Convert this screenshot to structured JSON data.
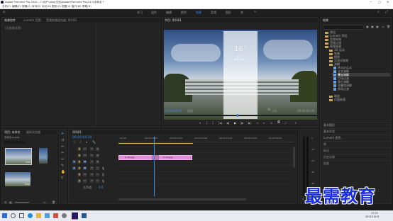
{
  "window": {
    "title": "Adobe Premiere Pro 2020 - C:\\用户\\blog\\文档\\Adobe\\Premiere Pro\\14.0\\未命名 *",
    "menu": [
      "文件(F)",
      "编辑(E)",
      "剪辑(C)",
      "序列(S)",
      "标记(M)",
      "图形(G)",
      "视图(V)",
      "窗口(W)",
      "帮助(H)"
    ],
    "controls": [
      "−",
      "□",
      "✕"
    ]
  },
  "workspaces": {
    "tabs": [
      "学习",
      "组件",
      "编辑",
      "颜色",
      "效果",
      "音频",
      "图形",
      "库"
    ],
    "active_index": 4
  },
  "source_panel": {
    "tabs": [
      "效果控件",
      "Lumetri 范围",
      "音频剪辑混合器: 序列01"
    ],
    "active_index": 0,
    "empty_text": "(无剪辑选择)"
  },
  "program_monitor": {
    "tab": "节目: 序列01",
    "timecode": "00:00:04:20",
    "fit": "适合",
    "quality": "1/2",
    "duration": "00:00:05:00",
    "overlay": {
      "big": "16°",
      "small_lines": [
        "多云",
        "2021/10/15"
      ]
    },
    "transport": [
      "▾",
      "|",
      "{",
      "}",
      "|◀",
      "◀|",
      "▶",
      "|▶",
      "▶|",
      "⇥",
      "⇤",
      "⊡",
      "📷",
      "⤢",
      "+"
    ]
  },
  "project_panel": {
    "tabs": [
      "项目: 未命名",
      "媒体浏览器"
    ],
    "file": "未命名.prproj",
    "thumbs": [
      {
        "name": "01.jpg",
        "dur": "5:00"
      },
      {
        "name": "序列01",
        "dur": "5:00"
      },
      {
        "name": "01.mp4",
        "dur": "5:00"
      }
    ]
  },
  "timeline": {
    "tab": "序列01",
    "timecode": "00:00:04:20",
    "ruler": [
      "00:00",
      "00:00:05:00",
      "00:00:10:00",
      "00:00:15:00",
      "00:00:20:00",
      "00:00:25:00",
      "00:00:30:00"
    ],
    "tracks": [
      {
        "name": "V3"
      },
      {
        "name": "V2"
      },
      {
        "name": "V1"
      },
      {
        "name": "A1"
      },
      {
        "name": "A2"
      },
      {
        "name": "A3"
      }
    ],
    "master": "主声道",
    "master_value": "0.0",
    "clips": [
      {
        "label": "fx 01.jpg"
      },
      {
        "label": "fx 01.jpg"
      }
    ],
    "meter_labels": [
      "0",
      "-12",
      "-24",
      "-36",
      "-48",
      "dB"
    ]
  },
  "effects_panel": {
    "tab": "效果",
    "items": [
      {
        "label": "预设",
        "indent": 0,
        "type": "folder"
      },
      {
        "label": "Lumetri 预设",
        "indent": 0,
        "type": "folder"
      },
      {
        "label": "音频效果",
        "indent": 0,
        "type": "folder"
      },
      {
        "label": "音频过渡",
        "indent": 0,
        "type": "folder"
      },
      {
        "label": "视频效果",
        "indent": 0,
        "type": "folder"
      },
      {
        "label": "3D 运动",
        "indent": 1,
        "type": "folder"
      },
      {
        "label": "划像",
        "indent": 1,
        "type": "folder"
      },
      {
        "label": "擦除",
        "indent": 1,
        "type": "folder"
      },
      {
        "label": "沉浸式视频",
        "indent": 1,
        "type": "folder"
      },
      {
        "label": "溶解",
        "indent": 1,
        "type": "folder"
      },
      {
        "label": "MorphCut",
        "indent": 2,
        "type": "file"
      },
      {
        "label": "交叉溶解",
        "indent": 2,
        "type": "file"
      },
      {
        "label": "叠加溶解",
        "indent": 2,
        "type": "file",
        "selected": true
      },
      {
        "label": "白场过渡",
        "indent": 2,
        "type": "file"
      },
      {
        "label": "胶片溶解",
        "indent": 2,
        "type": "file"
      },
      {
        "label": "非叠加溶解",
        "indent": 2,
        "type": "file"
      },
      {
        "label": "黑场过渡",
        "indent": 2,
        "type": "file"
      },
      {
        "label": "缩放",
        "indent": 1,
        "type": "folder"
      },
      {
        "label": "页面剥落",
        "indent": 1,
        "type": "folder"
      }
    ],
    "bottom_tabs": [
      "基本图形",
      "基本声音",
      "Lumetri 颜色",
      "库",
      "标记",
      "历史记录",
      "信息"
    ]
  },
  "taskbar": {
    "time": "17:25",
    "date": "2021/10/15"
  },
  "watermark": "最需教育"
}
